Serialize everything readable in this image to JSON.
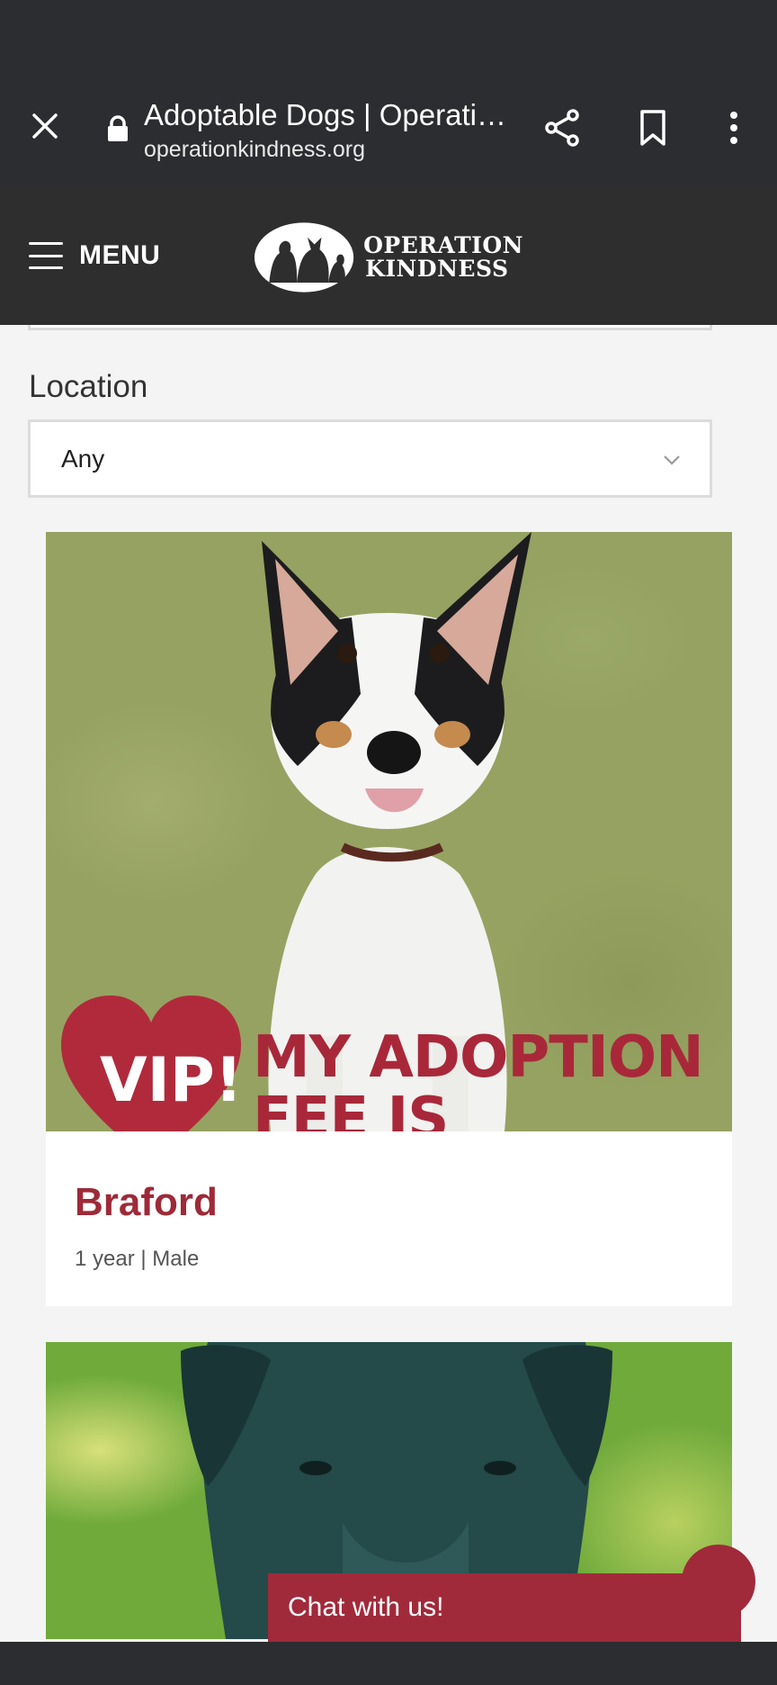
{
  "browser": {
    "title": "Adoptable Dogs | Operati…",
    "url": "operationkindness.org"
  },
  "header": {
    "menu_label": "MENU",
    "logo_line1": "OPERATION",
    "logo_line2": "KINDNESS"
  },
  "filters": {
    "location_label": "Location",
    "location_value": "Any"
  },
  "listings": [
    {
      "badge": "VIP!",
      "banner_line1": "MY ADOPTION",
      "banner_line2": "FEE IS WAIVED!",
      "name": "Braford",
      "meta": "1 year | Male"
    }
  ],
  "chat": {
    "label": "Chat with us!"
  },
  "colors": {
    "brand": "#9e2a38",
    "chrome": "#2c2d30",
    "header": "#2e2e2e"
  }
}
